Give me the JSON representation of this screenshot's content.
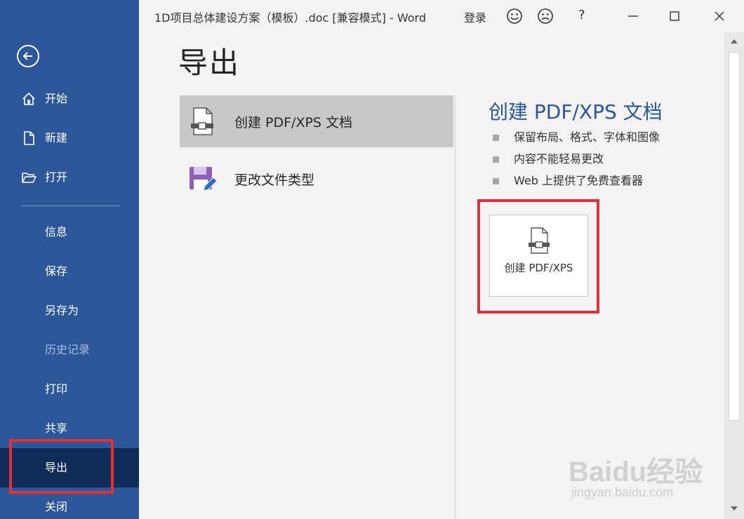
{
  "app": {
    "title": "1D项目总体建设方案（模板）.doc [兼容模式]  -  Word",
    "login": "登录",
    "help": "?"
  },
  "icons": {
    "back": "back-arrow-icon",
    "smile": "smile-icon",
    "frown": "frown-icon",
    "minimize": "minimize-icon",
    "maximize": "maximize-icon",
    "close": "close-icon"
  },
  "colors": {
    "sidebar_bg": "#2b579a",
    "sidebar_active": "#0f2b58",
    "accent_title": "#2b579a",
    "highlight_red": "#e0303a",
    "disabled_text": "#a9bcdc"
  },
  "sidebar": {
    "items": [
      {
        "label": "开始",
        "icon": "home-icon"
      },
      {
        "label": "新建",
        "icon": "new-document-icon"
      },
      {
        "label": "打开",
        "icon": "folder-open-icon"
      },
      {
        "label": "信息"
      },
      {
        "label": "保存"
      },
      {
        "label": "另存为"
      },
      {
        "label": "历史记录",
        "disabled": true
      },
      {
        "label": "打印"
      },
      {
        "label": "共享"
      },
      {
        "label": "导出",
        "active": true
      },
      {
        "label": "关闭"
      }
    ]
  },
  "main": {
    "page_title": "导出",
    "options": [
      {
        "label": "创建 PDF/XPS 文档",
        "icon": "pdf-document-icon",
        "selected": true
      },
      {
        "label": "更改文件类型",
        "icon": "save-edit-icon"
      }
    ],
    "detail": {
      "title": "创建 PDF/XPS 文档",
      "bullets": [
        "保留布局、格式、字体和图像",
        "内容不能轻易更改",
        "Web 上提供了免费查看器"
      ],
      "button_label": "创建 PDF/XPS"
    }
  },
  "watermark": {
    "brand": "Baidu经验",
    "url": "jingyan.baidu.com"
  }
}
